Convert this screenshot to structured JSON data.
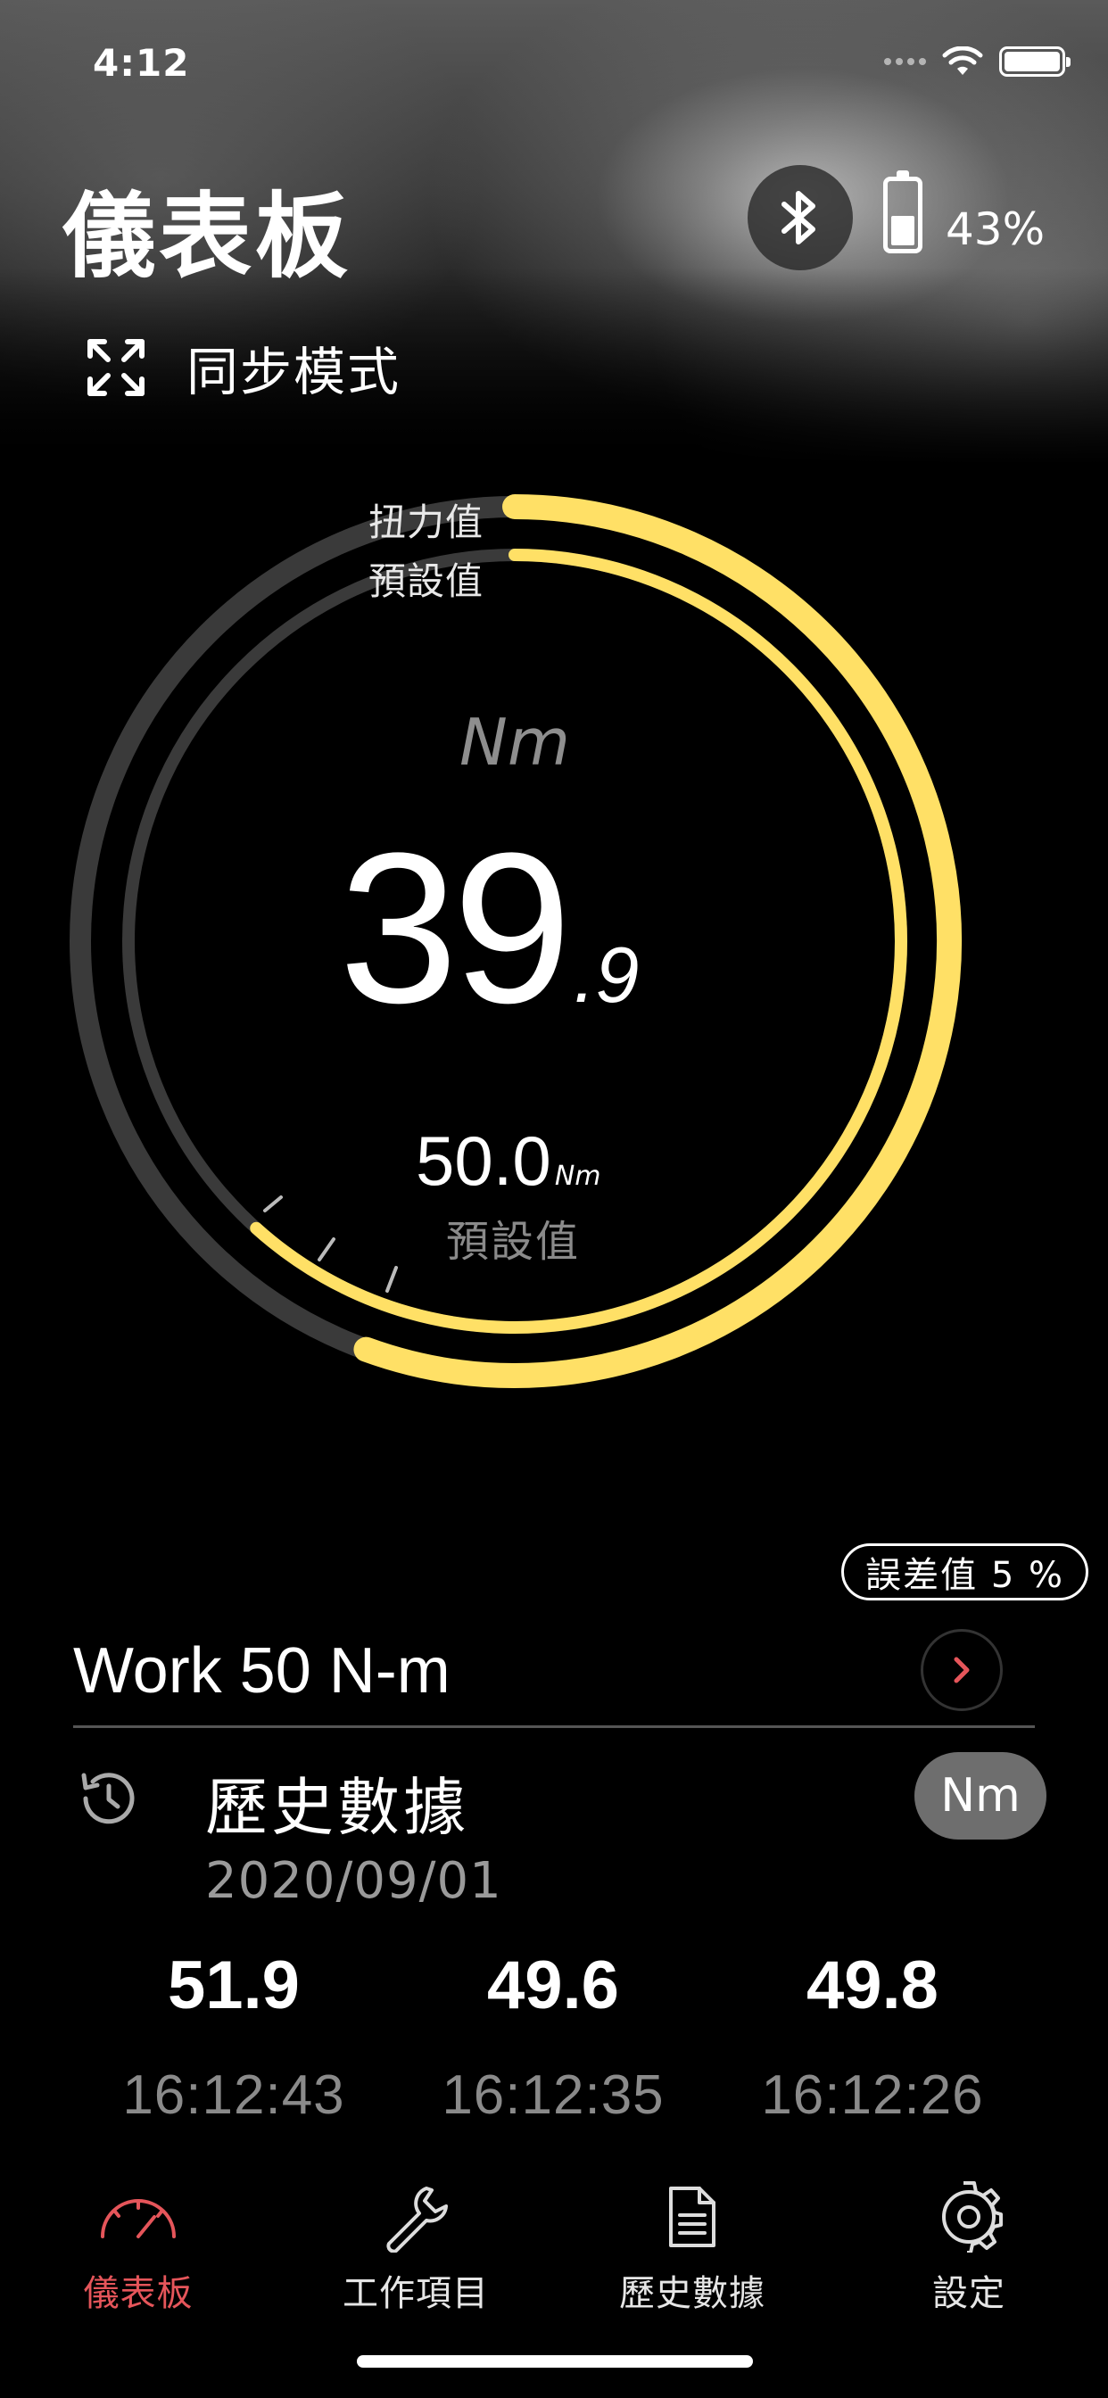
{
  "status_bar": {
    "time": "4:12"
  },
  "header": {
    "title": "儀表板",
    "battery_percent": "43%",
    "battery_level": 0.43
  },
  "sync": {
    "label": "同步模式"
  },
  "gauge": {
    "outer_label": "扭力值",
    "inner_label": "預設值",
    "unit": "Nm",
    "reading_int": "39",
    "reading_dec": ".9",
    "preset_value": "50.0",
    "preset_unit": "Nm",
    "preset_caption": "預設值",
    "torque_value": 39.9,
    "preset_setting": 50.0,
    "accent_color": "#ffe066",
    "track_color": "#3a3a3a"
  },
  "tolerance": {
    "label": "誤差值 5 %"
  },
  "work": {
    "title": "Work 50 N-m"
  },
  "history": {
    "title": "歷史數據",
    "unit_toggle": "Nm",
    "date": "2020/09/01",
    "readings": [
      {
        "value": "51.9",
        "time": "16:12:43"
      },
      {
        "value": "49.6",
        "time": "16:12:35"
      },
      {
        "value": "49.8",
        "time": "16:12:26"
      }
    ]
  },
  "tabs": [
    {
      "label": "儀表板",
      "icon": "speedometer-icon",
      "active": true
    },
    {
      "label": "工作項目",
      "icon": "wrench-icon",
      "active": false
    },
    {
      "label": "歷史數據",
      "icon": "document-icon",
      "active": false
    },
    {
      "label": "設定",
      "icon": "gear-icon",
      "active": false
    }
  ],
  "colors": {
    "active_tab": "#e5555a",
    "accent": "#ffe066"
  }
}
